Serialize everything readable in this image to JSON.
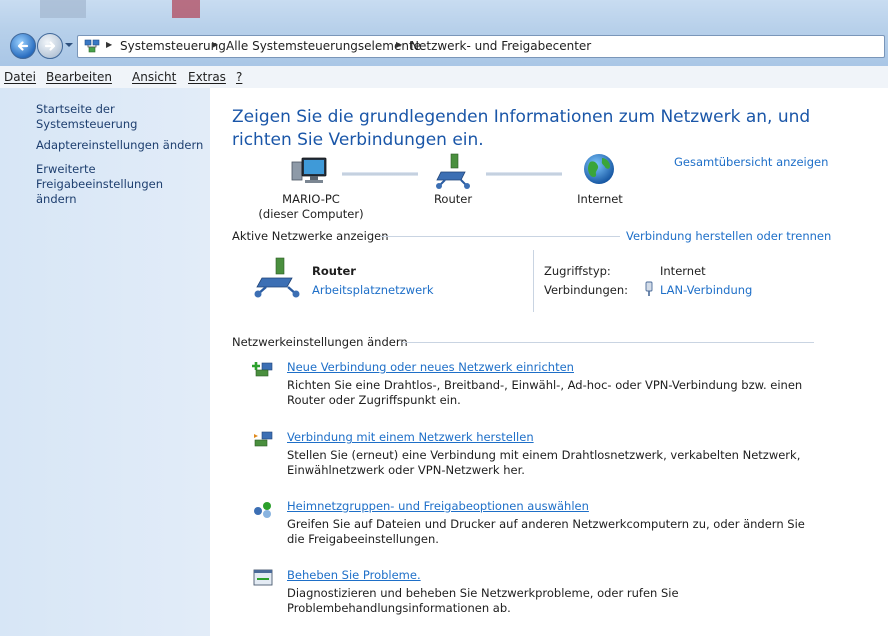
{
  "address": {
    "crumbs": [
      "Systemsteuerung",
      "Alle Systemsteuerungselemente",
      "Netzwerk- und Freigabecenter"
    ]
  },
  "menu": [
    "Datei",
    "Bearbeiten",
    "Ansicht",
    "Extras",
    "?"
  ],
  "sidebar": {
    "items": [
      {
        "label": "Startseite der Systemsteuerung"
      },
      {
        "label": "Adaptereinstellungen ändern"
      },
      {
        "label": "Erweiterte Freigabeeinstellungen ändern"
      }
    ]
  },
  "main": {
    "title": "Zeigen Sie die grundlegenden Informationen zum Netzwerk an, und richten Sie Verbindungen ein.",
    "full_map_link": "Gesamtübersicht anzeigen",
    "map": {
      "computer_name": "MARIO-PC",
      "computer_sub": "(dieser Computer)",
      "router": "Router",
      "internet": "Internet"
    },
    "active_header": "Aktive Netzwerke anzeigen",
    "connect_link": "Verbindung herstellen oder trennen",
    "network": {
      "name": "Router",
      "type_link": "Arbeitsplatznetzwerk",
      "access_label": "Zugriffstyp:",
      "access_value": "Internet",
      "conn_label": "Verbindungen:",
      "conn_value": "LAN-Verbindung"
    },
    "settings_header": "Netzwerkeinstellungen ändern",
    "tasks": [
      {
        "link": "Neue Verbindung oder neues Netzwerk einrichten",
        "desc": "Richten Sie eine Drahtlos-, Breitband-, Einwähl-, Ad-hoc- oder VPN-Verbindung bzw. einen Router oder Zugriffspunkt ein."
      },
      {
        "link": "Verbindung mit einem Netzwerk herstellen",
        "desc": "Stellen Sie (erneut) eine Verbindung mit einem Drahtlosnetzwerk, verkabelten Netzwerk, Einwählnetzwerk oder VPN-Netzwerk her."
      },
      {
        "link": "Heimnetzgruppen- und Freigabeoptionen auswählen",
        "desc": "Greifen Sie auf Dateien und Drucker auf anderen Netzwerkcomputern zu, oder ändern Sie die Freigabeeinstellungen."
      },
      {
        "link": "Beheben Sie Probleme.",
        "desc": "Diagnostizieren und beheben Sie Netzwerkprobleme, oder rufen Sie Problembehandlungsinformationen ab."
      }
    ]
  }
}
